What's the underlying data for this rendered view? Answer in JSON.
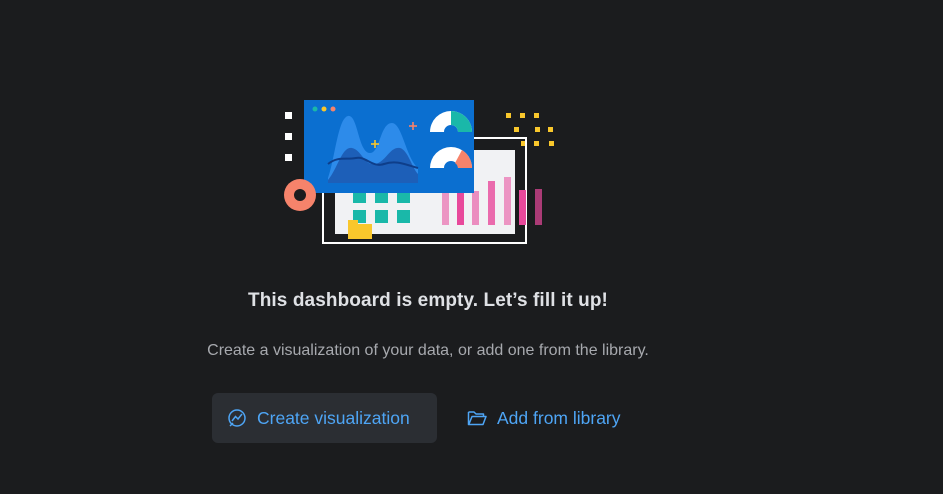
{
  "empty_state": {
    "title": "This dashboard is empty. Let’s fill it up!",
    "description": "Create a visualization of your data, or add one from the library."
  },
  "actions": {
    "create_label": "Create visualization",
    "create_icon": "visualization-icon",
    "library_label": "Add from library",
    "library_icon": "folder-open-icon"
  },
  "colors": {
    "background": "#1b1c1e",
    "accent_link": "#4ea5f5",
    "panel_blue": "#0b6fd0",
    "teal": "#1ab8a9",
    "pink": "#e8499b",
    "coral": "#f6836b",
    "yellow": "#f9c72c"
  }
}
